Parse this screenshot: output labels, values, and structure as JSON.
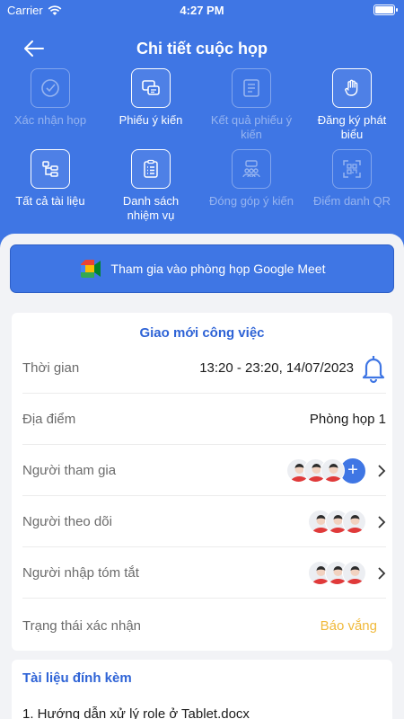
{
  "status": {
    "carrier": "Carrier",
    "time": "4:27 PM"
  },
  "header": {
    "title": "Chi tiết cuộc họp"
  },
  "actions": [
    {
      "label": "Xác nhận họp",
      "icon": "check-circle-icon",
      "enabled": false
    },
    {
      "label": "Phiếu ý kiến",
      "icon": "chat-form-icon",
      "enabled": true
    },
    {
      "label": "Kết quả phiếu ý kiến",
      "icon": "form-results-icon",
      "enabled": false
    },
    {
      "label": "Đăng ký phát biểu",
      "icon": "raised-hand-icon",
      "enabled": true
    },
    {
      "label": "Tất cả tài liệu",
      "icon": "document-tree-icon",
      "enabled": true
    },
    {
      "label": "Danh sách nhiệm vụ",
      "icon": "clipboard-list-icon",
      "enabled": true
    },
    {
      "label": "Đóng góp ý kiến",
      "icon": "group-feedback-icon",
      "enabled": false
    },
    {
      "label": "Điểm danh QR",
      "icon": "qr-scan-icon",
      "enabled": false
    }
  ],
  "meet": {
    "label": "Tham gia vào phòng họp Google Meet",
    "icon": "google-meet-icon"
  },
  "meeting": {
    "title": "Giao mới công việc",
    "time_label": "Thời gian",
    "time_value": "13:20 - 23:20, 14/07/2023",
    "location_label": "Địa điểm",
    "location_value": "Phòng họp 1",
    "participants_label": "Người tham gia",
    "followers_label": "Người theo dõi",
    "summary_label": "Người nhập tóm tắt",
    "confirm_label": "Trạng thái xác nhận",
    "confirm_value": "Báo vắng"
  },
  "attachments": {
    "title": "Tài liệu đính kèm",
    "files": [
      "1. Hướng dẫn xử lý role ở Tablet.docx"
    ]
  },
  "colors": {
    "primary": "#3f76e4",
    "accent_title": "#2e63d6",
    "status_absent": "#f0b93a"
  }
}
